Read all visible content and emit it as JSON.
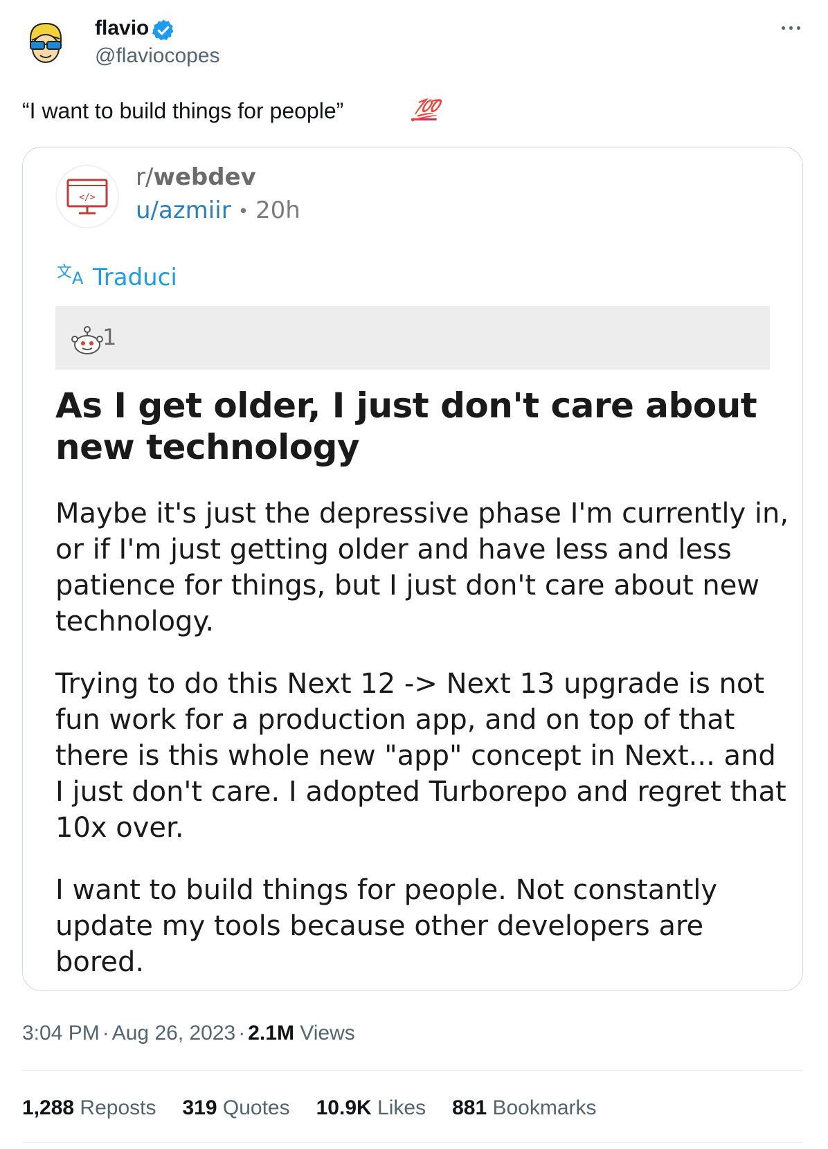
{
  "tweet": {
    "author_name": "flavio",
    "handle": "@flaviocopes",
    "text": "“I want to build things for people”",
    "emoji": "💯",
    "time": "3:04 PM",
    "date": "Aug 26, 2023",
    "views_count": "2.1M",
    "views_label": "Views"
  },
  "quote": {
    "subreddit_prefix": "r/",
    "subreddit_name": "webdev",
    "user": "u/azmiir",
    "separator": "•",
    "age": "20h",
    "translate_label": "Traduci",
    "award_count": "1",
    "title": "As I get older, I just don't care about new technology",
    "paragraphs": [
      "Maybe it's just the depressive phase I'm currently in, or if I'm just getting older and have less and less patience for things, but I just don't care about new technology.",
      "Trying to do this Next 12 -> Next 13 upgrade is not fun work for a production app, and on top of that there is this whole new \"app\" concept in Next... and I just don't care. I adopted Turborepo and regret that 10x over.",
      "I want to build things for people. Not constantly update my tools because other developers are bored."
    ]
  },
  "stats": {
    "reposts_count": "1,288",
    "reposts_label": "Reposts",
    "quotes_count": "319",
    "quotes_label": "Quotes",
    "likes_count": "10.9K",
    "likes_label": "Likes",
    "bookmarks_count": "881",
    "bookmarks_label": "Bookmarks"
  },
  "icons": {
    "verified": "verified-badge-icon",
    "more": "more-options-icon",
    "translate": "translate-icon",
    "award": "reddit-award-icon",
    "subreddit_logo": "code-monitor-icon"
  },
  "colors": {
    "accent": "#1d9bf0",
    "reddit_link": "#2a7fc1",
    "subreddit_logo": "#c23b3b",
    "muted": "#536471"
  }
}
